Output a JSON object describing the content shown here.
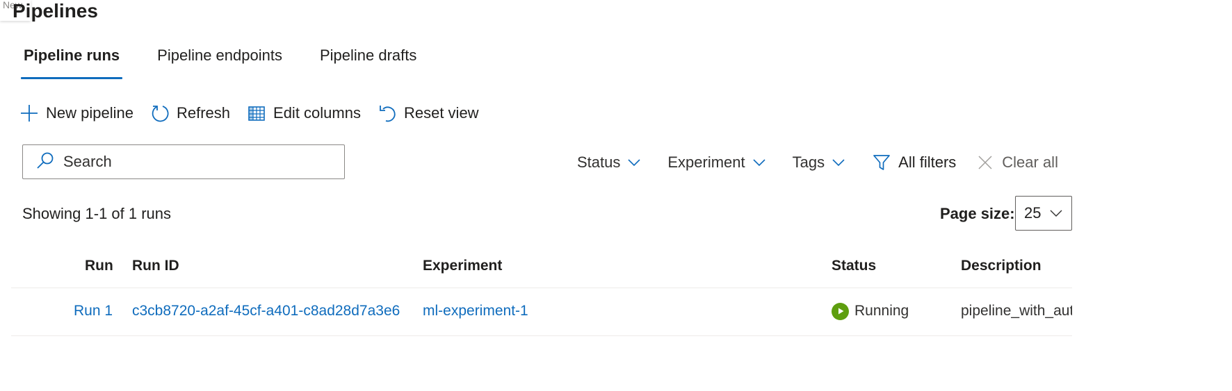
{
  "ghost_tip": "New",
  "page_title": "Pipelines",
  "tabs": [
    {
      "label": "Pipeline runs",
      "active": true
    },
    {
      "label": "Pipeline endpoints",
      "active": false
    },
    {
      "label": "Pipeline drafts",
      "active": false
    }
  ],
  "commands": {
    "new_pipeline": "New pipeline",
    "refresh": "Refresh",
    "edit_columns": "Edit columns",
    "reset_view": "Reset view"
  },
  "search": {
    "placeholder": "Search",
    "value": ""
  },
  "filters": {
    "status": "Status",
    "experiment": "Experiment",
    "tags": "Tags",
    "all_filters": "All filters",
    "clear_all": "Clear all"
  },
  "summary": {
    "showing": "Showing 1-1 of 1 runs"
  },
  "page_size": {
    "label": "Page size:",
    "value": "25"
  },
  "table": {
    "columns": [
      "Run",
      "Run ID",
      "Experiment",
      "Status",
      "Description"
    ],
    "rows": [
      {
        "run": "Run 1",
        "run_id": "c3cb8720-a2af-45cf-a401-c8ad28d7a3e6",
        "experiment": "ml-experiment-1",
        "status": "Running",
        "description": "pipeline_with_aut"
      }
    ]
  },
  "colors": {
    "accent": "#0f6cbd",
    "running": "#5e9e0f",
    "text": "#201f1e"
  }
}
